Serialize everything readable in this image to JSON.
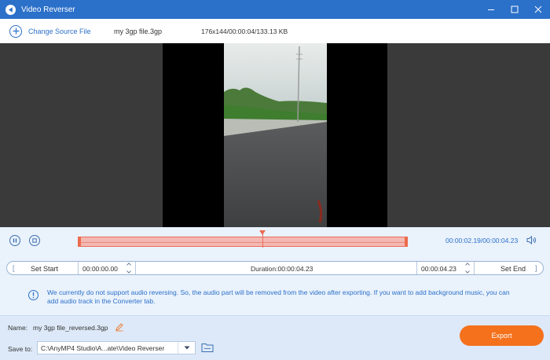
{
  "window": {
    "title": "Video Reverser",
    "icon": "reverse-play-icon",
    "controls": [
      "minimize-icon",
      "maximize-icon",
      "close-icon"
    ]
  },
  "source": {
    "change_label": "Change Source File",
    "filename": "my 3gp file.3gp",
    "info": "176x144/00:00:04/133.13 KB"
  },
  "playback": {
    "pause_icon": "pause-icon",
    "stop_icon": "stop-icon",
    "timecode": "00:00:02.19/00:00:04.23",
    "volume_icon": "volume-icon",
    "playhead_fraction": 0.563
  },
  "trim": {
    "left_bracket": "[",
    "right_bracket": "]",
    "set_start_label": "Set Start",
    "start_value": "00:00:00.00",
    "duration": "Duration:00:00:04.23",
    "end_value": "00:00:04.23",
    "set_end_label": "Set End"
  },
  "notice": {
    "icon": "info-icon",
    "text": "We currently do not support audio reversing. So, the audio part will be removed from the video after exporting. If you want to add background music, you can add audio track in the Converter tab."
  },
  "output": {
    "name_label": "Name:",
    "name_value": "my 3gp file_reversed.3gp",
    "save_to_label": "Save to:",
    "save_path": "C:\\AnyMP4 Studio\\A...ate\\Video Reverser",
    "export_label": "Export"
  },
  "colors": {
    "title_bar": "#2b70c9",
    "accent": "#2b70c9",
    "export": "#f5711c",
    "timeline": "#f4b8b2"
  }
}
